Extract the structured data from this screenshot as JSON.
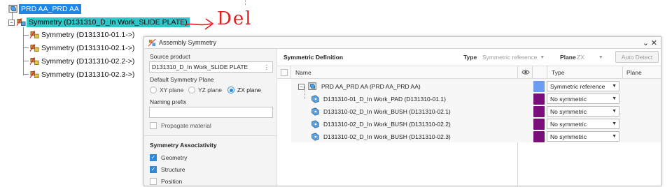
{
  "tree": {
    "root_label": "PRD AA_PRD AA",
    "symmetry_label": "Symmetry (D131310_D_In Work_SLIDE PLATE)",
    "children": [
      "Symmetry (D131310-01.1->)",
      "Symmetry (D131310-02.1->)",
      "Symmetry (D131310-02.2->)",
      "Symmetry (D131310-02.3->)"
    ]
  },
  "annotation": {
    "arrow_text": "Del",
    "color": "#e02020"
  },
  "dialog": {
    "title": "Assembly Symmetry",
    "minimize": "⌄",
    "close": "✕",
    "left": {
      "source_product_label": "Source product",
      "source_product_value": "D131310_D_In Work_SLIDE PLATE",
      "default_plane_label": "Default Symmetry Plane",
      "planes": [
        "XY plane",
        "YZ plane",
        "ZX plane"
      ],
      "selected_plane": "ZX plane",
      "naming_prefix_label": "Naming prefix",
      "naming_prefix_value": "",
      "propagate_label": "Propagate material",
      "assoc_header": "Symmetry Associativity",
      "assoc": [
        {
          "label": "Geometry",
          "checked": true
        },
        {
          "label": "Structure",
          "checked": true
        },
        {
          "label": "Position",
          "checked": false
        }
      ]
    },
    "right": {
      "section_title": "Symmetric Definition",
      "type_label": "Type",
      "type_value": "Symmetric reference",
      "plane_label": "Plane",
      "plane_value": "ZX",
      "auto_detect": "Auto Detect",
      "columns": {
        "name": "Name",
        "type": "Type",
        "plane": "Plane"
      },
      "rows": [
        {
          "name": "PRD AA_PRD AA (PRD AA_PRD AA)",
          "color": "#6b9cf0",
          "type": "Symmetric reference",
          "root": true
        },
        {
          "name": "D131310-01_D_In Work_PAD (D131310-01.1)",
          "color": "#7a0f7a",
          "type": "No symmetric",
          "root": false
        },
        {
          "name": "D131310-02_D_In Work_BUSH (D131310-02.1)",
          "color": "#7a0f7a",
          "type": "No symmetric",
          "root": false
        },
        {
          "name": "D131310-02_D_In Work_BUSH (D131310-02.2)",
          "color": "#7a0f7a",
          "type": "No symmetric",
          "root": false
        },
        {
          "name": "D131310-02_D_In Work_BUSH (D131310-02.3)",
          "color": "#7a0f7a",
          "type": "No symmetric",
          "root": false
        }
      ]
    }
  },
  "colors": {
    "root_highlight": "#1f86e6",
    "symmetry_highlight": "#2cc7c7",
    "accent": "#2f88d6"
  }
}
